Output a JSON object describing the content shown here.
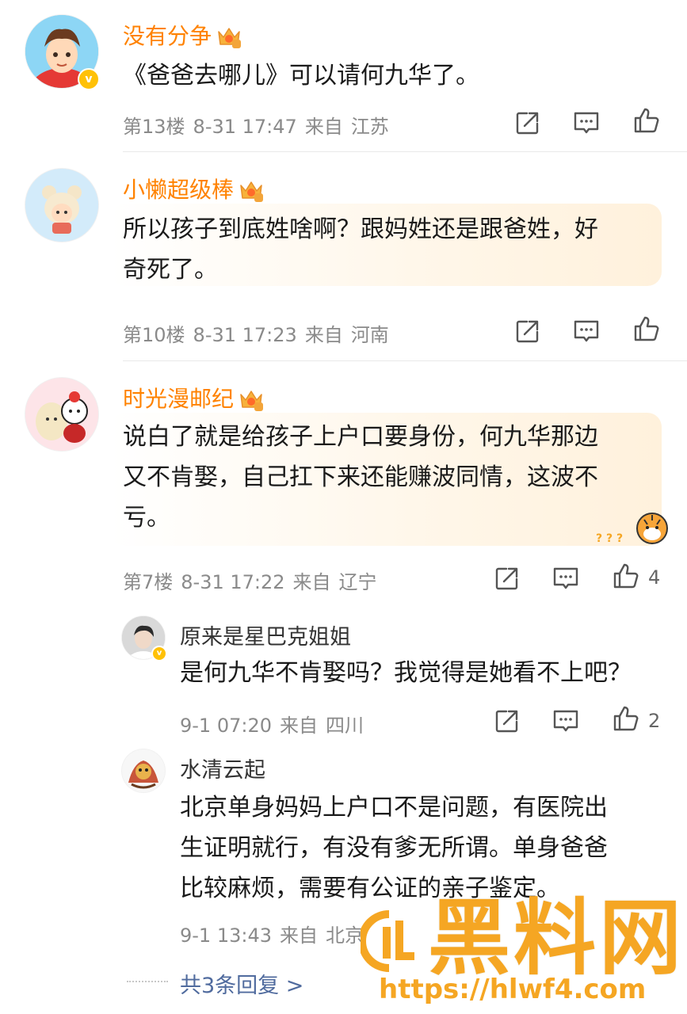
{
  "comments": [
    {
      "user": "没有分争",
      "level": "6",
      "text_lines": [
        "《爸爸去哪儿》可以请何九华了。"
      ],
      "floor": "第13楼",
      "time": "8-31 17:47",
      "from_label": "来自",
      "location": "江苏",
      "likes": ""
    },
    {
      "user": "小懒超级棒",
      "level": "7",
      "text_lines": [
        "所以孩子到底姓啥啊？跟妈姓还是跟爸姓，好",
        "奇死了。"
      ],
      "floor": "第10楼",
      "time": "8-31 17:23",
      "from_label": "来自",
      "location": "河南",
      "likes": ""
    },
    {
      "user": "时光漫邮纪",
      "level": "6",
      "text_lines": [
        "说白了就是给孩子上户口要身份，何九华那边",
        "又不肯娶，自己扛下来还能赚波同情，这波不",
        "亏。"
      ],
      "floor": "第7楼",
      "time": "8-31 17:22",
      "from_label": "来自",
      "location": "辽宁",
      "likes": "4",
      "sticker_text": "? ? ?"
    }
  ],
  "replies": [
    {
      "user": "原来是星巴克姐姐",
      "text_lines": [
        "是何九华不肯娶吗？我觉得是她看不上吧？"
      ],
      "time": "9-1 07:20",
      "from_label": "来自",
      "location": "四川",
      "likes": "2"
    },
    {
      "user": "水清云起",
      "text_lines": [
        "北京单身妈妈上户口不是问题，有医院出",
        "生证明就行，有没有爹无所谓。单身爸爸",
        "比较麻烦，需要有公证的亲子鉴定。"
      ],
      "time": "9-1 13:43",
      "from_label": "来自",
      "location": "北京"
    }
  ],
  "more_replies": "共3条回复 >",
  "watermark": {
    "brand": "黑料网",
    "url": "https://hlwf4.com",
    "color": "#f5a623"
  },
  "colors": {
    "username": "#ff8200",
    "link": "#506b9e",
    "meta": "#8a8a8a"
  },
  "icons": [
    "share-icon",
    "comment-icon",
    "like-icon",
    "verified-badge-icon",
    "crown-level-icon"
  ]
}
